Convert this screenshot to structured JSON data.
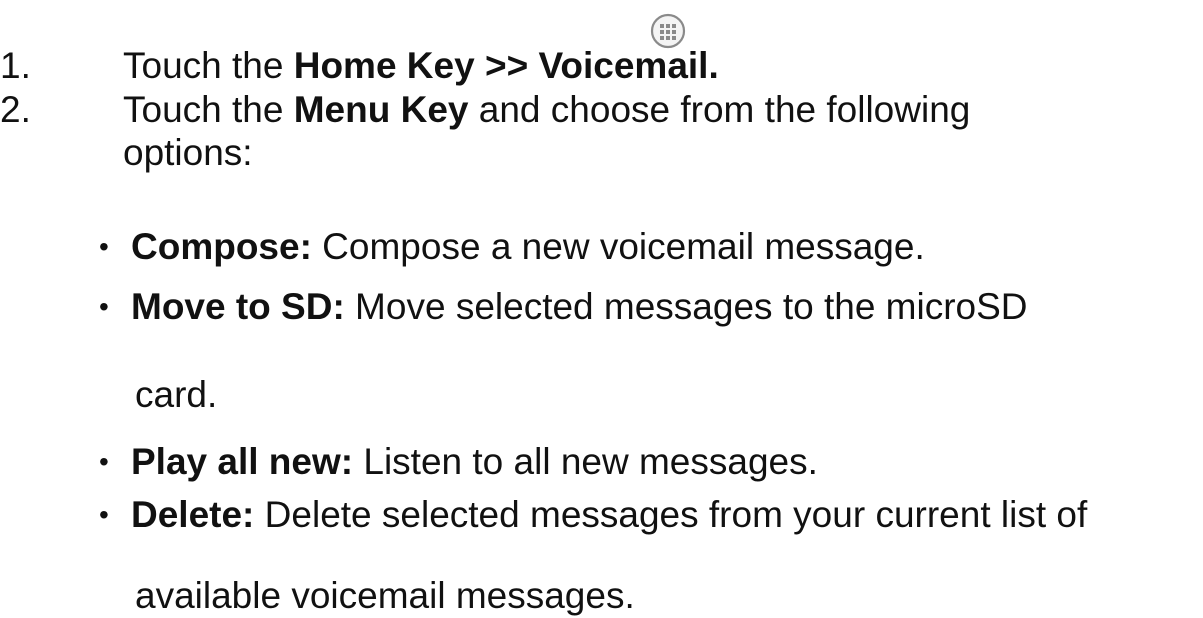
{
  "steps": [
    {
      "number": "1.",
      "prefix": "Touch the ",
      "bold": "Home Key >> Voicemail.",
      "suffix": ""
    },
    {
      "number": "2.",
      "prefix": "Touch the ",
      "bold": "Menu Key",
      "suffix": " and choose from the following",
      "continuation": "options:"
    }
  ],
  "options": [
    {
      "label": "Compose:",
      "text": " Compose a new voicemail message.",
      "continuation": ""
    },
    {
      "label": "Move to SD:",
      "text": " Move selected messages to the microSD",
      "continuation": "card."
    },
    {
      "label": "Play all new:",
      "text": " Listen to all new messages.",
      "continuation": ""
    },
    {
      "label": "Delete:",
      "text": " Delete selected messages from your current list of",
      "continuation": "available voicemail messages."
    }
  ],
  "bullet_glyph": "•",
  "icons": {
    "apps": "apps-grid-icon"
  }
}
